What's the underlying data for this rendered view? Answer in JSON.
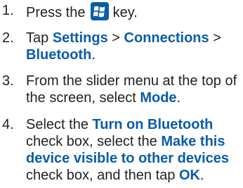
{
  "steps": [
    {
      "number": "1.",
      "prefix": "Press the",
      "icon": "windows-start-key-icon",
      "suffix": "key."
    },
    {
      "number": "2.",
      "t1": "Tap",
      "settings": "Settings",
      "sep1": ">",
      "connections": "Connections",
      "sep2": ">",
      "bluetooth": "Bluetooth",
      "end": "."
    },
    {
      "number": "3.",
      "line1": "From the slider menu at the top of",
      "line2_pre": "the screen, select",
      "mode": "Mode",
      "end": "."
    },
    {
      "number": "4.",
      "sel1": "Select the",
      "turn_on": "Turn on Bluetooth",
      "check1": "check box, select the",
      "make_visible_1": "Make this",
      "make_visible_2": "device visible to other devices",
      "check2": "check box, and then tap",
      "ok": "OK",
      "end": "."
    }
  ],
  "colors": {
    "text": "#222222",
    "emphasis": "#0a5ca8",
    "key_bg": "#0a5ca8"
  }
}
